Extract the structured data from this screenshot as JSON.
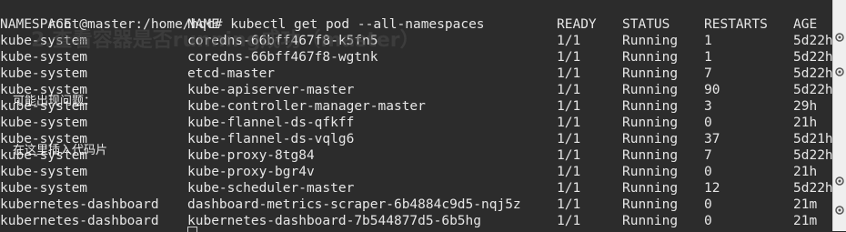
{
  "terminal": {
    "prompt": "root@master:/home/hqc#",
    "command": "kubectl get pod --all-namespaces",
    "headers": {
      "namespace": "NAMESPACE",
      "name": "NAME",
      "ready": "READY",
      "status": "STATUS",
      "restarts": "RESTARTS",
      "age": "AGE"
    },
    "rows": [
      {
        "namespace": "kube-system",
        "name": "coredns-66bff467f8-k5fn5",
        "ready": "1/1",
        "status": "Running",
        "restarts": "1",
        "age": "5d22h"
      },
      {
        "namespace": "kube-system",
        "name": "coredns-66bff467f8-wgtnk",
        "ready": "1/1",
        "status": "Running",
        "restarts": "1",
        "age": "5d22h"
      },
      {
        "namespace": "kube-system",
        "name": "etcd-master",
        "ready": "1/1",
        "status": "Running",
        "restarts": "7",
        "age": "5d22h"
      },
      {
        "namespace": "kube-system",
        "name": "kube-apiserver-master",
        "ready": "1/1",
        "status": "Running",
        "restarts": "90",
        "age": "5d22h"
      },
      {
        "namespace": "kube-system",
        "name": "kube-controller-manager-master",
        "ready": "1/1",
        "status": "Running",
        "restarts": "3",
        "age": "29h"
      },
      {
        "namespace": "kube-system",
        "name": "kube-flannel-ds-qfkff",
        "ready": "1/1",
        "status": "Running",
        "restarts": "0",
        "age": "21h"
      },
      {
        "namespace": "kube-system",
        "name": "kube-flannel-ds-vqlg6",
        "ready": "1/1",
        "status": "Running",
        "restarts": "37",
        "age": "5d21h"
      },
      {
        "namespace": "kube-system",
        "name": "kube-proxy-8tg84",
        "ready": "1/1",
        "status": "Running",
        "restarts": "7",
        "age": "5d22h"
      },
      {
        "namespace": "kube-system",
        "name": "kube-proxy-bgr4v",
        "ready": "1/1",
        "status": "Running",
        "restarts": "0",
        "age": "21h"
      },
      {
        "namespace": "kube-system",
        "name": "kube-scheduler-master",
        "ready": "1/1",
        "status": "Running",
        "restarts": "12",
        "age": "5d22h"
      },
      {
        "namespace": "kubernetes-dashboard",
        "name": "dashboard-metrics-scraper-6b4884c9d5-nqj5z",
        "ready": "1/1",
        "status": "Running",
        "restarts": "0",
        "age": "21m"
      },
      {
        "namespace": "kubernetes-dashboard",
        "name": "kubernetes-dashboard-7b544877d5-6b5hg",
        "ready": "1/1",
        "status": "Running",
        "restarts": "0",
        "age": "21m"
      }
    ]
  },
  "overlay": {
    "heading": "2.查看容器是否running成功（master）",
    "question_label": "可能出现问题：",
    "code_placeholder": "在这里插入代码片"
  },
  "colors": {
    "terminal_bg": "#2c2c2c",
    "terminal_fg": "#e6e6e6",
    "toolbar_bg": "#efefef"
  },
  "icons": [
    "gear-icon",
    "gear-icon",
    "gear-icon",
    "gear-icon"
  ]
}
